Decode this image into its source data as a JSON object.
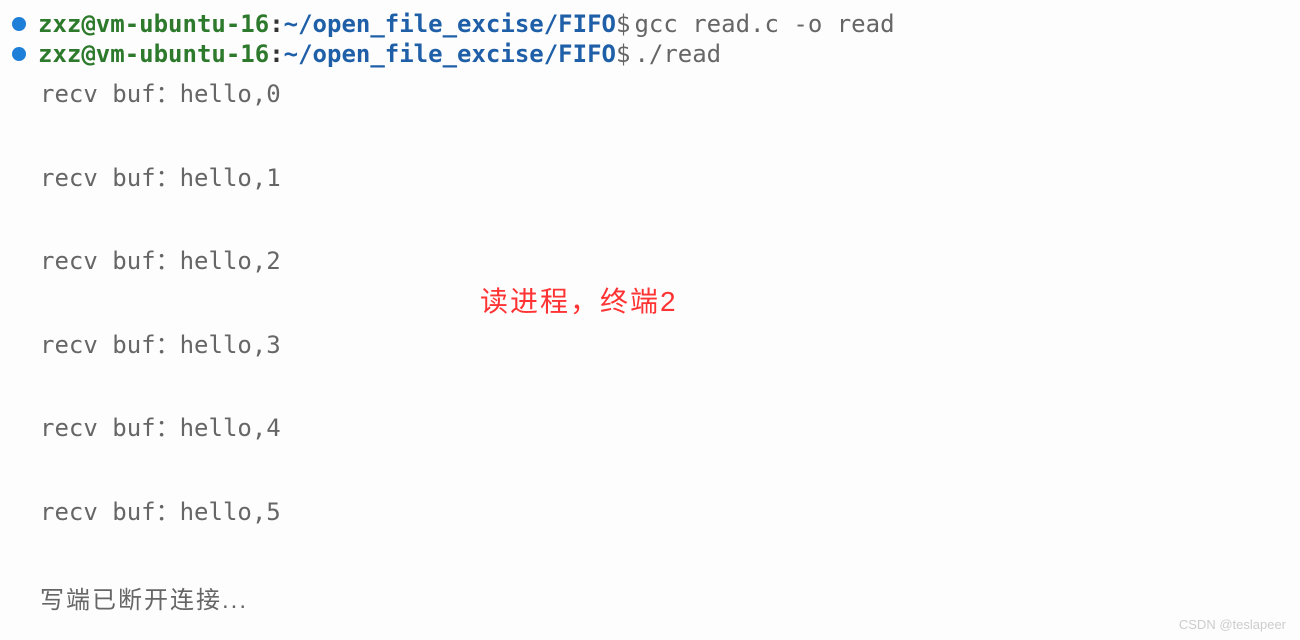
{
  "prompts": [
    {
      "user_host": "zxz@vm-ubuntu-16",
      "separator": ":",
      "path": "~/open_file_excise/FIFO",
      "dollar": "$",
      "command": "gcc read.c -o read"
    },
    {
      "user_host": "zxz@vm-ubuntu-16",
      "separator": ":",
      "path": "~/open_file_excise/FIFO",
      "dollar": "$",
      "command": "./read"
    }
  ],
  "output": [
    "recv buf：hello,0",
    "recv buf：hello,1",
    "recv buf：hello,2",
    "recv buf：hello,3",
    "recv buf：hello,4",
    "recv buf：hello,5"
  ],
  "disconnect": "写端已断开连接...",
  "annotation": "读进程，终端2",
  "watermark": "CSDN @teslapeer"
}
